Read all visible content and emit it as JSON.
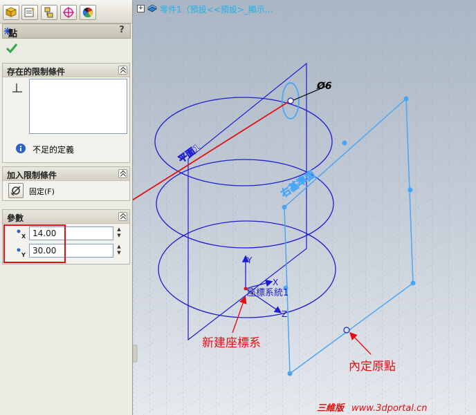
{
  "panel": {
    "tab_icons": [
      "feature-manager-icon",
      "property-manager-icon",
      "configuration-manager-icon",
      "dimxpert-icon",
      "display-manager-icon"
    ],
    "title": "點",
    "help_label": "?",
    "ok_icon": "checkmark-icon",
    "existing_relations": {
      "header": "存在的限制條件",
      "status_text": "不足的定義"
    },
    "add_relations": {
      "header": "加入限制條件",
      "fix_label": "固定(F)"
    },
    "parameters": {
      "header": "參數",
      "x_label": "X",
      "x_value": "14.00",
      "y_label": "Y",
      "y_value": "30.00"
    }
  },
  "graphics": {
    "tree_text": "零件1（預設<<預設>_顯示...",
    "plane1_label": "平面1",
    "right_plane_label": "右基準面",
    "coord_label": "座標系統1",
    "axis_x": "X",
    "axis_y": "Y",
    "axis_z": "Z",
    "dimension_label": "Ø6",
    "annotation_new_coord": "新建座標系",
    "annotation_origin": "內定原點",
    "watermark_brand": "三維版",
    "watermark_url": "www.3dportal.cn"
  },
  "colors": {
    "panel_bg": "#ecebe3",
    "sketch_blue": "#1c1cd0",
    "plane_blue": "#4aa6f4",
    "annotation_red": "#e01010"
  }
}
